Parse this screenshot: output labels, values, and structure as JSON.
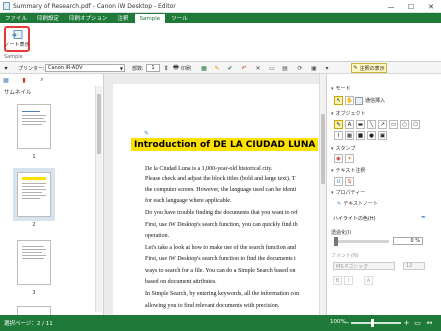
{
  "window": {
    "title": "Summary of Research.pdf - Canon iW Desktop - Editor",
    "minimize_glyph": "—",
    "maximize_glyph": "☐",
    "close_glyph": "✕"
  },
  "menu": [
    "ファイル",
    "印刷設定",
    "印刷オプション",
    "注釈",
    "Sample",
    "ツール"
  ],
  "ribbon": {
    "note_button_label": "ノート表示",
    "group_label": "Sample"
  },
  "toolbar": {
    "printer_label": "プリンター:",
    "printer_value": "Canon iR-ADV",
    "copies_label": "部数:",
    "copies_value": "1",
    "print_label": "印刷",
    "annotations_button": "注釈の表示"
  },
  "left_panel": {
    "thumbnails_title": "サムネイル",
    "page_numbers": [
      "1",
      "2",
      "3"
    ]
  },
  "document": {
    "heading": "Introduction of DE LA CIUDAD LUNA",
    "lines": [
      "De la Ciudad Luna is a 1,000-year-old historical city.",
      "Please check and adjust the block titles (bold and large text). T",
      "the computer screen. However, the language used can be identi",
      "for each language where applicable.",
      "Do you have trouble finding the documents that you want to ref",
      "First, use iW Desktop's search function, you can quickly find th",
      "operation.",
      "Let's take a look at how to make use of the search function and",
      "First, use iW Desktop's search function to find the documents t",
      "ways to search for a file. You can do a Simple Search based on",
      "based on document attributes.",
      "In Simple Search, by entering keywords, all the information con",
      "allowing you to find relevant documents with precision."
    ]
  },
  "right_panel": {
    "mode_title": "モード",
    "insert_text_label": "通信挿入",
    "objects_title": "オブジェクト",
    "stamp_title": "スタンプ",
    "text_annotation_title": "テキスト注釈",
    "properties_title": "プロパティー",
    "text_note_label": "テキストノート",
    "highlight_color_label": "ハイライトの色(H)",
    "opacity_label": "透過化(I)",
    "opacity_value": "0 %",
    "font_label": "フォント(N)",
    "font_value": "MS Pゴシック",
    "font_size_value": "12"
  },
  "statusbar": {
    "page_status": "選択ページ：2 / 11",
    "zoom": "100%"
  },
  "colors": {
    "accent_green": "#1f7a3a",
    "highlight_yellow": "#ffe100",
    "note_button_outline": "#e53935"
  }
}
